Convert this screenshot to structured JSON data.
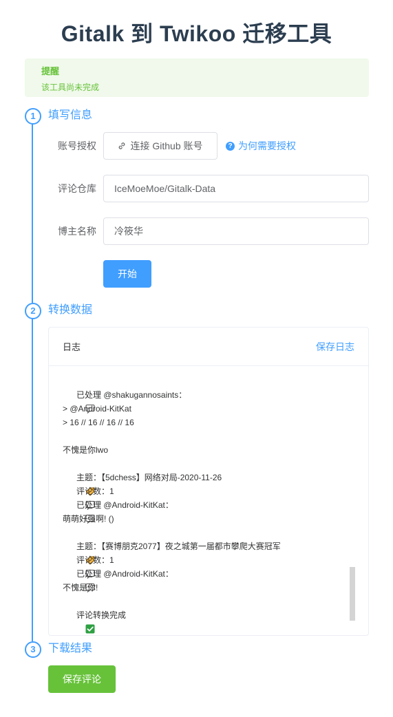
{
  "title": "Gitalk 到 Twikoo 迁移工具",
  "alert": {
    "title": "提醒",
    "description": "该工具尚未完成"
  },
  "steps": [
    {
      "number": "1",
      "title": "填写信息"
    },
    {
      "number": "2",
      "title": "转换数据"
    },
    {
      "number": "3",
      "title": "下载结果"
    }
  ],
  "form": {
    "auth_label": "账号授权",
    "auth_button": "连接 Github 账号",
    "auth_help": "为何需要授权",
    "repo_label": "评论仓库",
    "repo_value": "IceMoeMoe/Gitalk-Data",
    "owner_label": "博主名称",
    "owner_value": "冷筱华",
    "start_button": "开始"
  },
  "log": {
    "title": "日志",
    "save_label": "保存日志",
    "lines": {
      "l1": "已处理 @shakugannosaints：",
      "l2": "> @Android-KitKat",
      "l3": "> 16 // 16 // 16 // 16",
      "l4": "不愧是你lwo",
      "l5": "主题：【5dchess】网络对局-2020-11-26",
      "l6": "评论数：1",
      "l7": "已处理 @Android-KitKat：",
      "l8": "萌萌好强啊! ()",
      "l9": "主题：【赛博朋克2077】夜之城第一届都市攀爬大赛冠军",
      "l10": "评论数：1",
      "l11": "已处理 @Android-KitKat：",
      "l12": "不愧是你!",
      "l13": "评论转换完成"
    }
  },
  "save_comments_button": "保存评论",
  "colors": {
    "primary": "#409eff",
    "success": "#67c23a",
    "alert_bg": "#f0f9eb"
  }
}
